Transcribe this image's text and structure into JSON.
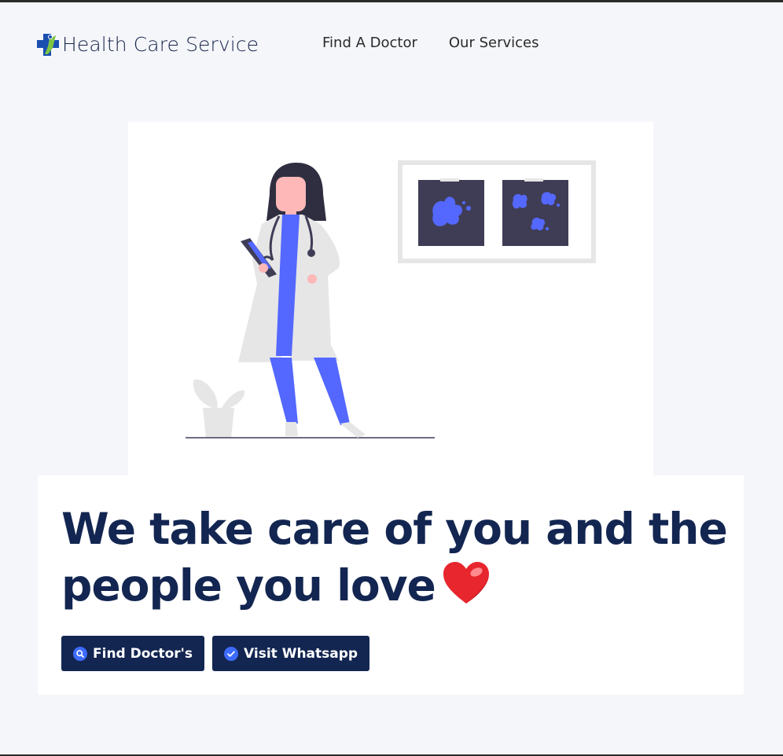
{
  "header": {
    "brand": "Health Care Service",
    "nav": [
      "Find A Doctor",
      "Our Services"
    ]
  },
  "hero": {
    "headline": "We take care of you and the people you love",
    "buttons": {
      "find": "Find Doctor's",
      "whatsapp": "Visit Whatsapp"
    }
  },
  "icons": {
    "logo": "medical-cross-person-icon",
    "heart": "heart-emoji-icon",
    "find": "search-icon",
    "whatsapp": "check-circle-icon"
  },
  "colors": {
    "primary": "#132651",
    "accent": "#5468ff",
    "background": "#f5f6fa",
    "heart": "#e8262e"
  }
}
